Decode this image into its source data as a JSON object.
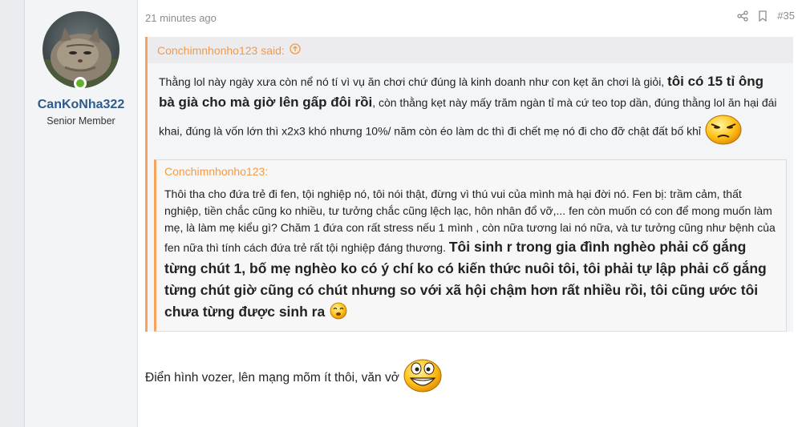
{
  "post": {
    "time": "21 minutes ago",
    "number": "#35"
  },
  "user": {
    "name": "CanKoNha322",
    "title": "Senior Member"
  },
  "quote": {
    "author": "Conchimnhonho123 said:",
    "text_before": "Thằng lol này ngày xưa còn nể nó tí vì vụ ăn chơi chứ đúng là kinh doanh như con kẹt ăn chơi là giỏi, ",
    "text_bold": "tôi có 15 tỉ ông bà già cho mà giờ lên gấp đôi rồi",
    "text_after": ", còn thằng kẹt này mấy trăm ngàn tỉ mà cứ teo top dần, đúng thằng lol ăn hại đái khai, đúng là vốn lớn thì x2x3 khó nhưng 10%/ năm còn éo làm dc thì đi chết mẹ nó đi cho đỡ chật đất bố khỉ"
  },
  "nested_quote": {
    "author": "Conchimnhonho123:",
    "text_before": "Thôi tha cho đứa trẻ đi fen, tội nghiệp nó, tôi nói thật, đừng vì thú vui của mình mà hại đời nó. Fen bị: trầm cảm, thất nghiệp, tiền chắc cũng ko nhiều, tư tưởng chắc cũng lệch lạc, hôn nhân đổ vỡ,... fen còn muốn có con để mong muốn làm mẹ, là làm mẹ kiểu gì? Chăm 1 đứa con rất stress nếu 1 mình , còn nữa tương lai nó nữa, và tư tưởng cũng như bệnh của fen nữa thì tính cách đứa trẻ rất tội nghiệp đáng thương. ",
    "text_bold": "Tôi sinh r trong gia đình nghèo phải cố gắng từng chút 1, bố mẹ nghèo ko có ý chí ko có kiến thức nuôi tôi, tôi phải tự lập phải cố gắng từng chút giờ cũng có chút nhưng so với xã hội chậm hơn rất nhiều rồi,  tôi cũng ước tôi chưa từng được sinh ra"
  },
  "reply": {
    "text": "Điển hình vozer, lên mạng mõm ít thôi, văn vở"
  },
  "icons": {
    "share": "share-icon",
    "bookmark": "bookmark-icon",
    "quote_link": "arrow-up-circle-icon",
    "online": "online-status-icon"
  },
  "colors": {
    "accent": "#f7a35c",
    "username": "#2f5a8a",
    "online": "#63b02f"
  }
}
